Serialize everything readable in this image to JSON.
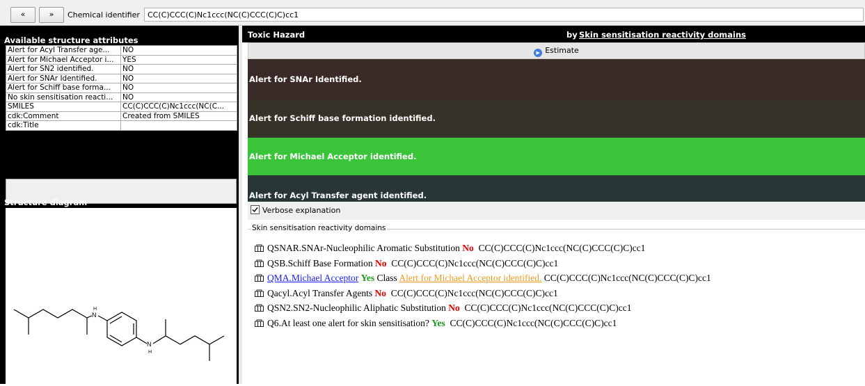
{
  "toolbar": {
    "back_label": "«",
    "forward_label": "»",
    "identifier_label": "Chemical identifier",
    "identifier_value": "CC(C)CCC(C)Nc1ccc(NC(C)CCC(C)C)cc1"
  },
  "left": {
    "attributes_title": "Available structure attributes",
    "attributes": [
      {
        "name": "Alert for Acyl Transfer age...",
        "value": "NO"
      },
      {
        "name": "Alert for Michael Acceptor i...",
        "value": "YES"
      },
      {
        "name": "Alert for SN2 identified.",
        "value": "NO"
      },
      {
        "name": "Alert for SNAr Identified.",
        "value": "NO"
      },
      {
        "name": "Alert for Schiff base forma...",
        "value": "NO"
      },
      {
        "name": "No skin sensitisation reacti...",
        "value": "NO"
      },
      {
        "name": "SMILES",
        "value": "CC(C)CCC(C)Nc1ccc(NC(C..."
      },
      {
        "name": "cdk:Comment",
        "value": "Created from SMILES"
      },
      {
        "name": "cdk:Title",
        "value": ""
      }
    ],
    "structure_title": "Structure diagram",
    "atom_label": "H"
  },
  "right": {
    "header_left": "Toxic Hazard",
    "header_by": "by",
    "header_right": "Skin sensitisation reactivity domains",
    "estimate_label": "Estimate",
    "alerts": [
      {
        "text": "Alert for SNAr Identified.",
        "color": "#3a2a28"
      },
      {
        "text": "Alert for Schiff base formation identified.",
        "color": "#363228"
      },
      {
        "text": "Alert for Michael Acceptor identified.",
        "color": "#39c439"
      },
      {
        "text": "Alert for Acyl Transfer agent identified.",
        "color": "#283638"
      }
    ],
    "verbose_label": "Verbose explanation",
    "verbose_checked": true,
    "results_legend": "Skin sensitisation reactivity domains",
    "results": [
      {
        "name": "QSNAR.SNAr-Nucleophilic Aromatic Substitution",
        "answer": "No",
        "class_text": "",
        "class_link": "",
        "smiles": "CC(C)CCC(C)Nc1ccc(NC(C)CCC(C)C)cc1"
      },
      {
        "name": "QSB.Schiff Base Formation",
        "answer": "No",
        "class_text": "",
        "class_link": "",
        "smiles": "CC(C)CCC(C)Nc1ccc(NC(C)CCC(C)C)cc1"
      },
      {
        "name": "QMA.Michael Acceptor",
        "answer": "Yes",
        "class_text": "Class",
        "class_link": "Alert for Michael Acceptor identified.",
        "smiles": "CC(C)CCC(C)Nc1ccc(NC(C)CCC(C)C)cc1"
      },
      {
        "name": "Qacyl.Acyl Transfer Agents",
        "answer": "No",
        "class_text": "",
        "class_link": "",
        "smiles": "CC(C)CCC(C)Nc1ccc(NC(C)CCC(C)C)cc1"
      },
      {
        "name": "QSN2.SN2-Nucleophilic Aliphatic Substitution",
        "answer": "No",
        "class_text": "",
        "class_link": "",
        "smiles": "CC(C)CCC(C)Nc1ccc(NC(C)CCC(C)C)cc1"
      },
      {
        "name": "Q6.At least one alert for skin sensitisation?",
        "answer": "Yes",
        "class_text": "",
        "class_link": "",
        "smiles": "CC(C)CCC(C)Nc1ccc(NC(C)CCC(C)C)cc1"
      }
    ]
  }
}
